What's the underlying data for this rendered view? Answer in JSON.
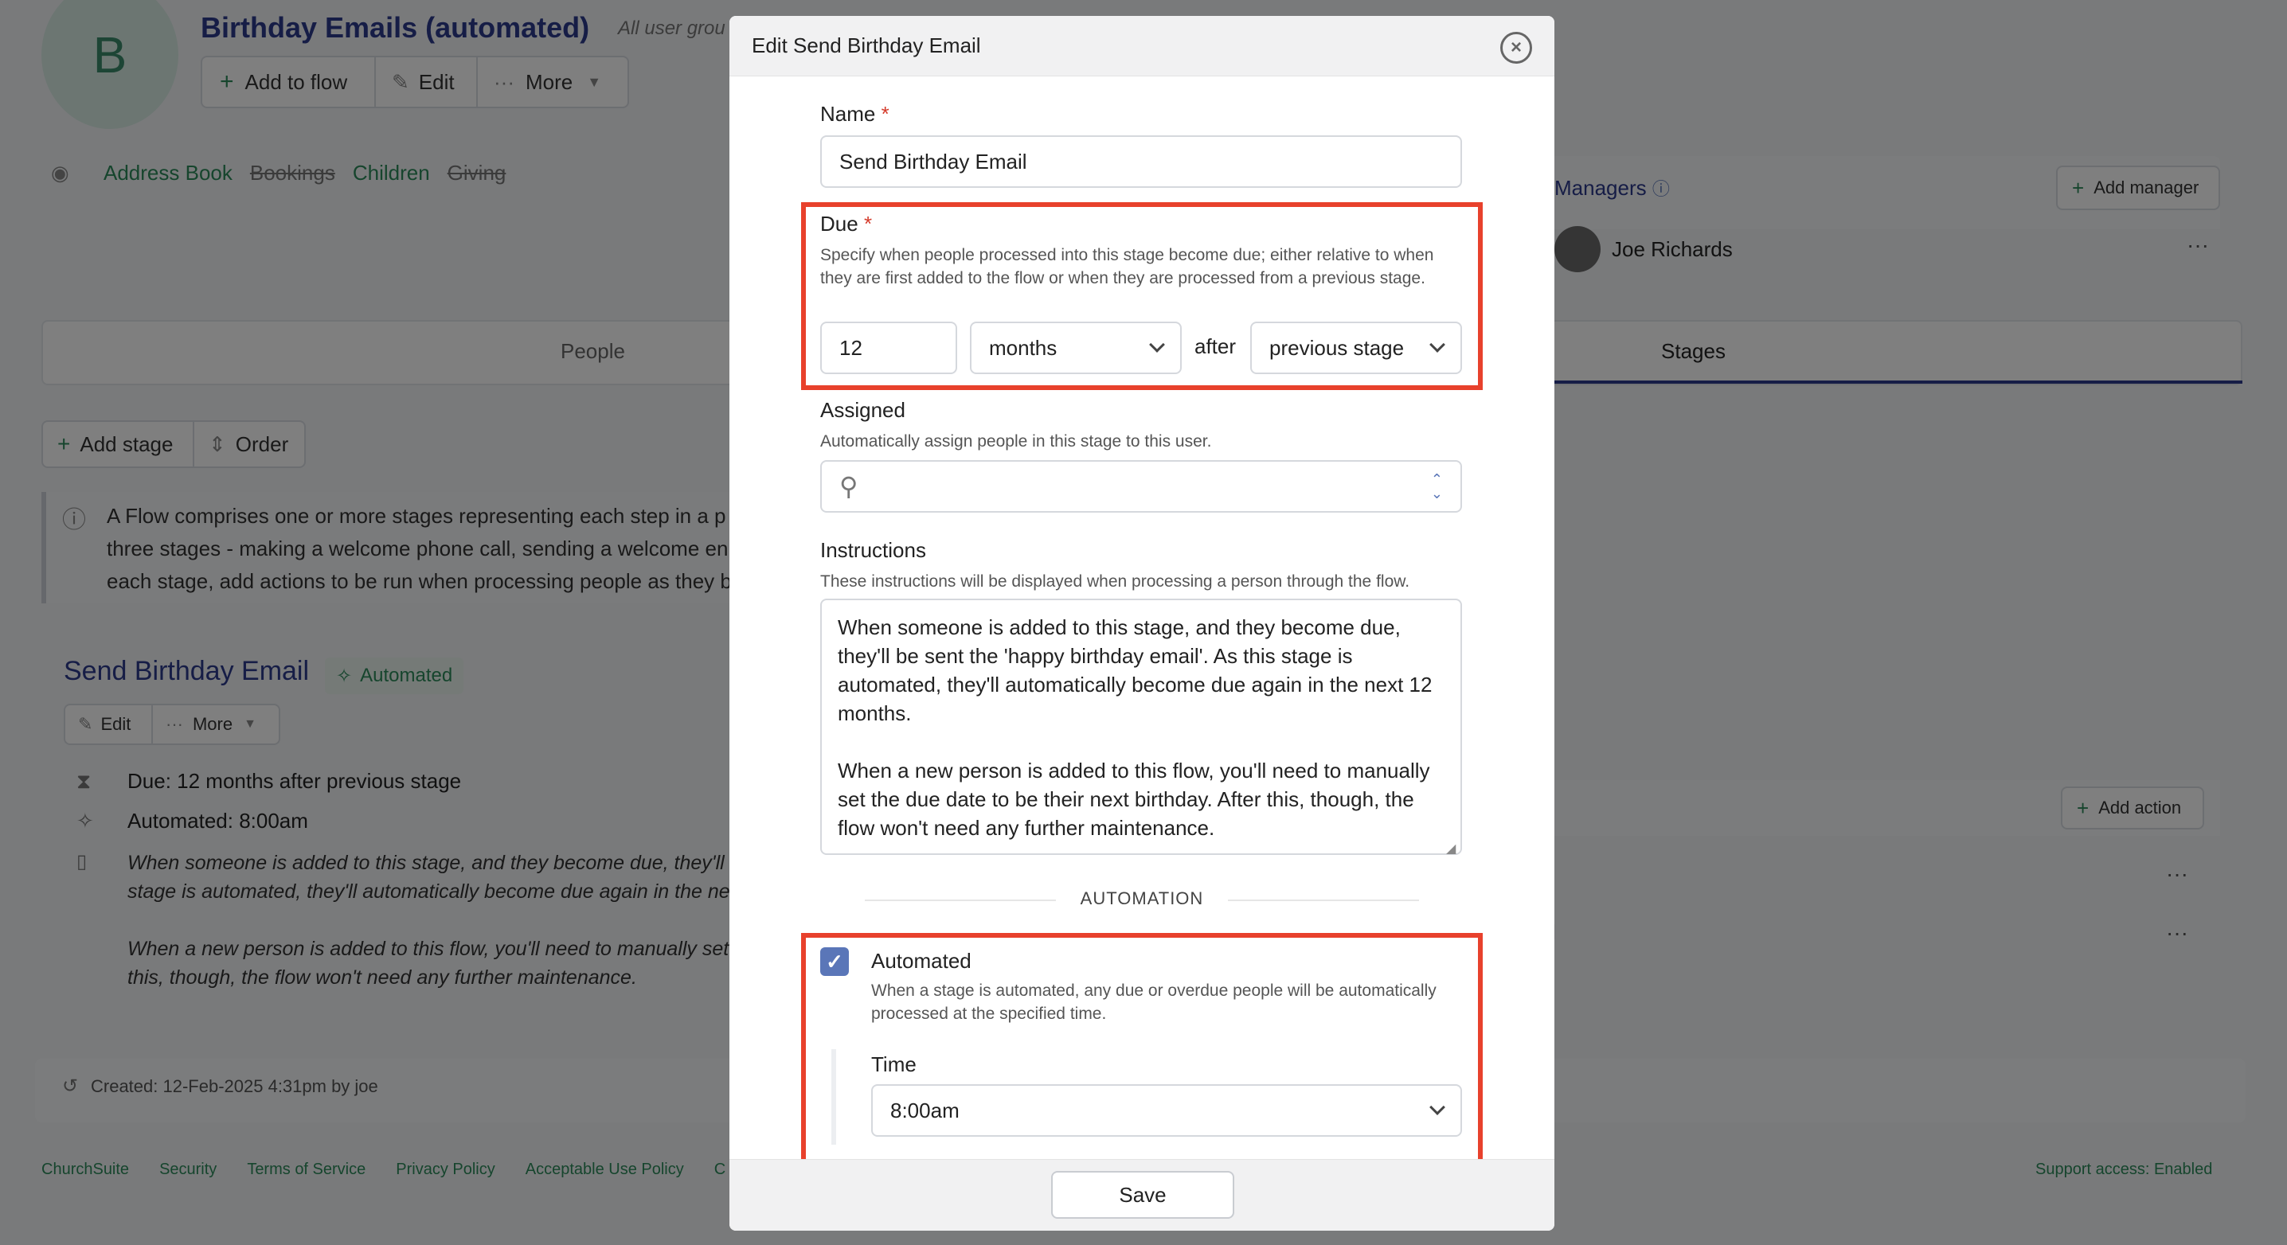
{
  "flow": {
    "avatar_letter": "B",
    "title": "Birthday Emails (automated)",
    "subtitle": "All user grou",
    "add_to_flow": "Add to flow",
    "edit": "Edit",
    "more": "More",
    "modules": [
      "Address Book",
      "Bookings",
      "Children",
      "Giving"
    ],
    "managers_heading": "Managers",
    "add_manager": "Add manager",
    "manager_name": "Joe Richards",
    "tabs": [
      "People",
      "Stages"
    ],
    "add_stage": "Add stage",
    "order": "Order",
    "info_lines": [
      "A Flow comprises one or more stages representing each step in a p",
      "three stages - making a welcome phone call, sending a welcome en",
      "each stage, add actions to be run when processing people as they b"
    ],
    "stage_title": "Send Birthday Email",
    "stage_badge": "Automated",
    "stage_edit": "Edit",
    "stage_more": "More",
    "add_action": "Add action",
    "due_summary": "Due: 12 months after previous stage",
    "automated_summary": "Automated: 8:00am",
    "instr_lines": [
      "When someone is added to this stage, and they become due, they'll b",
      "stage is automated, they'll automatically become due again in the ne",
      "When a new person is added to this flow, you'll need to manually set",
      "this, though, the flow won't need any further maintenance."
    ],
    "row_partial": "l",
    "created": "Created: 12-Feb-2025 4:31pm by joe"
  },
  "footer": {
    "links": [
      "ChurchSuite",
      "Security",
      "Terms of Service",
      "Privacy Policy",
      "Acceptable Use Policy",
      "C"
    ],
    "support": "Support access: Enabled"
  },
  "modal": {
    "title": "Edit Send Birthday Email",
    "name_label": "Name",
    "required_mark": "*",
    "name_value": "Send Birthday Email",
    "due_label": "Due",
    "due_help": "Specify when people processed into this stage become due; either relative to when they are first added to the flow or when they are processed from a previous stage.",
    "due_amount": "12",
    "due_unit": "months",
    "after": "after",
    "due_relative": "previous stage",
    "assigned_label": "Assigned",
    "assigned_help": "Automatically assign people in this stage to this user.",
    "instructions_label": "Instructions",
    "instructions_help": "These instructions will be displayed when processing a person through the flow.",
    "instructions_value": "When someone is added to this stage, and they become due, they'll be sent the 'happy birthday email'. As this stage is automated, they'll automatically become due again in the next 12 months.\n\nWhen a new person is added to this flow, you'll need to manually set the due date to be their next birthday. After this, though, the flow won't need any further maintenance.",
    "automation_heading": "AUTOMATION",
    "automated_label": "Automated",
    "automated_checked": true,
    "automated_help": "When a stage is automated, any due or overdue people will be automatically processed at the specified time.",
    "time_label": "Time",
    "time_value": "8:00am",
    "save": "Save"
  },
  "colors": {
    "accent": "#5a76b8",
    "highlight": "#e8412c",
    "link": "#2c8a5a",
    "title": "#2d3a8c"
  }
}
